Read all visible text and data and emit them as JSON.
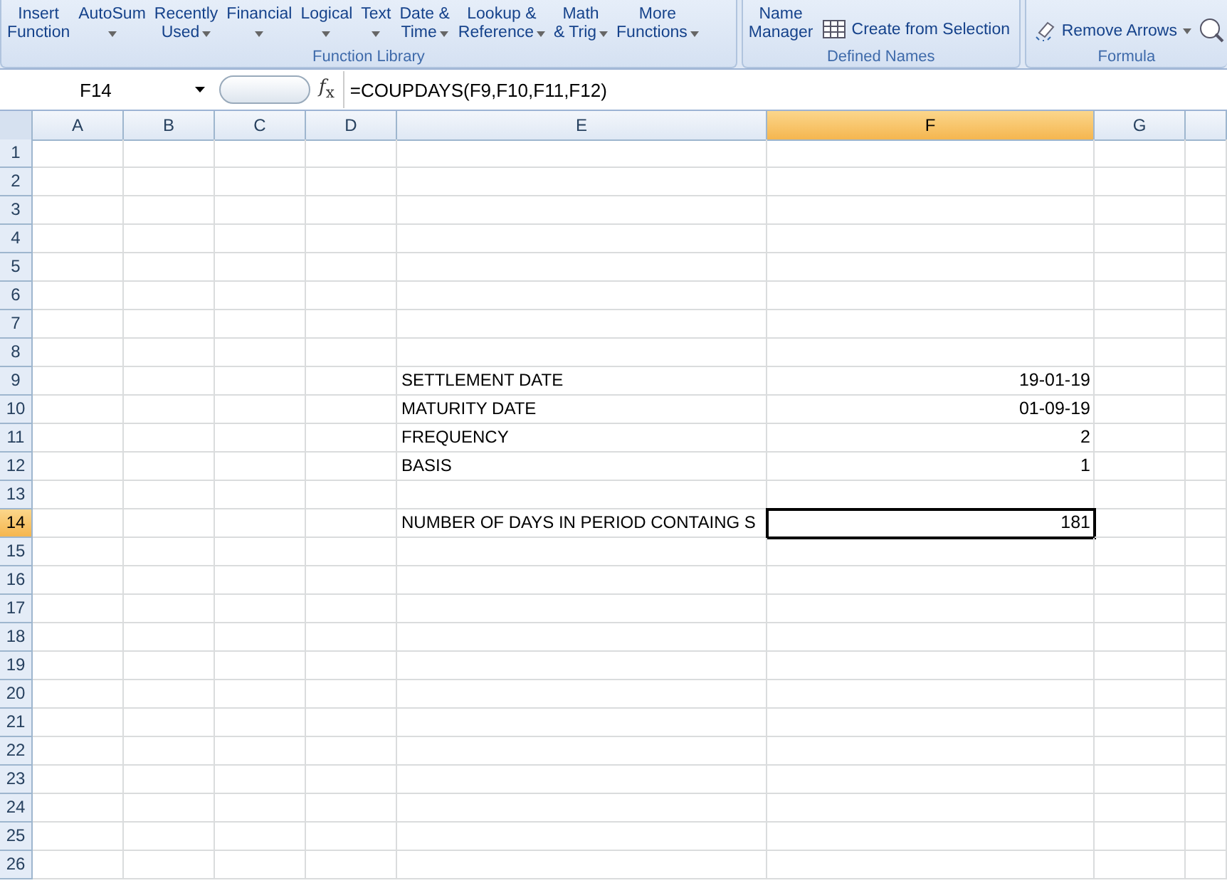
{
  "ribbon": {
    "groups": [
      {
        "title": "Function Library",
        "buttons": [
          {
            "kind": "big",
            "lines": [
              "Insert",
              "Function"
            ],
            "dropdown": false
          },
          {
            "kind": "big",
            "lines": [
              "AutoSum"
            ],
            "dropdown": true
          },
          {
            "kind": "big",
            "lines": [
              "Recently",
              "Used"
            ],
            "dropdown": true
          },
          {
            "kind": "big",
            "lines": [
              "Financial"
            ],
            "dropdown": true
          },
          {
            "kind": "big",
            "lines": [
              "Logical"
            ],
            "dropdown": true
          },
          {
            "kind": "big",
            "lines": [
              "Text"
            ],
            "dropdown": true
          },
          {
            "kind": "big",
            "lines": [
              "Date &",
              "Time"
            ],
            "dropdown": true
          },
          {
            "kind": "big",
            "lines": [
              "Lookup &",
              "Reference"
            ],
            "dropdown": true
          },
          {
            "kind": "big",
            "lines": [
              "Math",
              "& Trig"
            ],
            "dropdown": true
          },
          {
            "kind": "big",
            "lines": [
              "More",
              "Functions"
            ],
            "dropdown": true
          }
        ]
      },
      {
        "title": "Defined Names",
        "buttons": [
          {
            "kind": "big",
            "lines": [
              "Name",
              "Manager"
            ],
            "dropdown": false
          },
          {
            "kind": "small",
            "lines": [
              "Create from Selection"
            ],
            "dropdown": false
          }
        ]
      },
      {
        "title": "Formula",
        "buttons": [
          {
            "kind": "small",
            "lines": [
              "Remove Arrows"
            ],
            "dropdown": true
          }
        ]
      }
    ]
  },
  "name_box": "F14",
  "fx_button": "*f*$_{x}$",
  "formula": "=COUPDAYS(F9,F10,F11,F12)",
  "columns": [
    {
      "label": "A",
      "selected": false
    },
    {
      "label": "B",
      "selected": false
    },
    {
      "label": "C",
      "selected": false
    },
    {
      "label": "D",
      "selected": false
    },
    {
      "label": "E",
      "selected": false
    },
    {
      "label": "F",
      "selected": true
    },
    {
      "label": "G",
      "selected": false
    }
  ],
  "rows": [
    {
      "number": "1",
      "selected": false
    },
    {
      "number": "2",
      "selected": false
    },
    {
      "number": "3",
      "selected": false
    },
    {
      "number": "4",
      "selected": false
    },
    {
      "number": "5",
      "selected": false
    },
    {
      "number": "6",
      "selected": false
    },
    {
      "number": "7",
      "selected": false
    },
    {
      "number": "8",
      "selected": false
    },
    {
      "number": "9",
      "selected": false,
      "label": "SETTLEMENT DATE",
      "value": "19-01-19"
    },
    {
      "number": "10",
      "selected": false,
      "label": "MATURITY DATE",
      "value": "01-09-19"
    },
    {
      "number": "11",
      "selected": false,
      "label": "FREQUENCY",
      "value": "2"
    },
    {
      "number": "12",
      "selected": false,
      "label": "BASIS",
      "value": "1"
    },
    {
      "number": "13",
      "selected": false
    },
    {
      "number": "14",
      "selected": true,
      "label": "NUMBER OF DAYS IN PERIOD CONTAING S",
      "value": "181"
    },
    {
      "number": "15",
      "selected": false
    },
    {
      "number": "16",
      "selected": false
    },
    {
      "number": "17",
      "selected": false
    },
    {
      "number": "18",
      "selected": false
    },
    {
      "number": "19",
      "selected": false
    },
    {
      "number": "20",
      "selected": false
    },
    {
      "number": "21",
      "selected": false
    },
    {
      "number": "22",
      "selected": false
    },
    {
      "number": "23",
      "selected": false
    },
    {
      "number": "24",
      "selected": false
    },
    {
      "number": "25",
      "selected": false
    },
    {
      "number": "26",
      "selected": false
    }
  ]
}
